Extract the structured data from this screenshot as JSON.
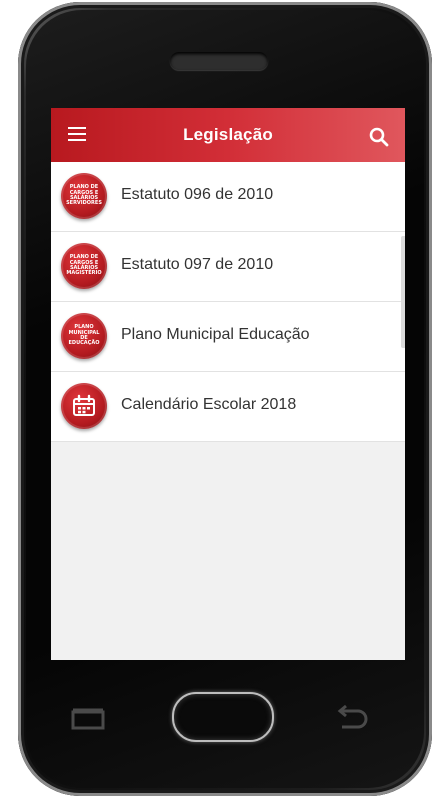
{
  "app": {
    "title": "Legislação"
  },
  "icons": {
    "menu": "hamburger-menu-icon",
    "search": "search-icon",
    "recent": "recent-apps-icon",
    "back": "back-icon"
  },
  "colors": {
    "appbar_start": "#b8191f",
    "appbar_end": "#e0575d",
    "badge": "#b41b20"
  },
  "items": [
    {
      "label": "Estatuto 096 de 2010",
      "badge_text": "PLANO DE CARGOS E SALÁRIOS SERVIDORES"
    },
    {
      "label": "Estatuto 097 de 2010",
      "badge_text": "PLANO DE CARGOS E SALÁRIOS MAGISTÉRIO"
    },
    {
      "label": "Plano Municipal Educação",
      "badge_text": "PLANO MUNICIPAL DE EDUCAÇÃO"
    },
    {
      "label": "Calendário Escolar 2018",
      "badge_icon": "calendar-icon"
    }
  ]
}
